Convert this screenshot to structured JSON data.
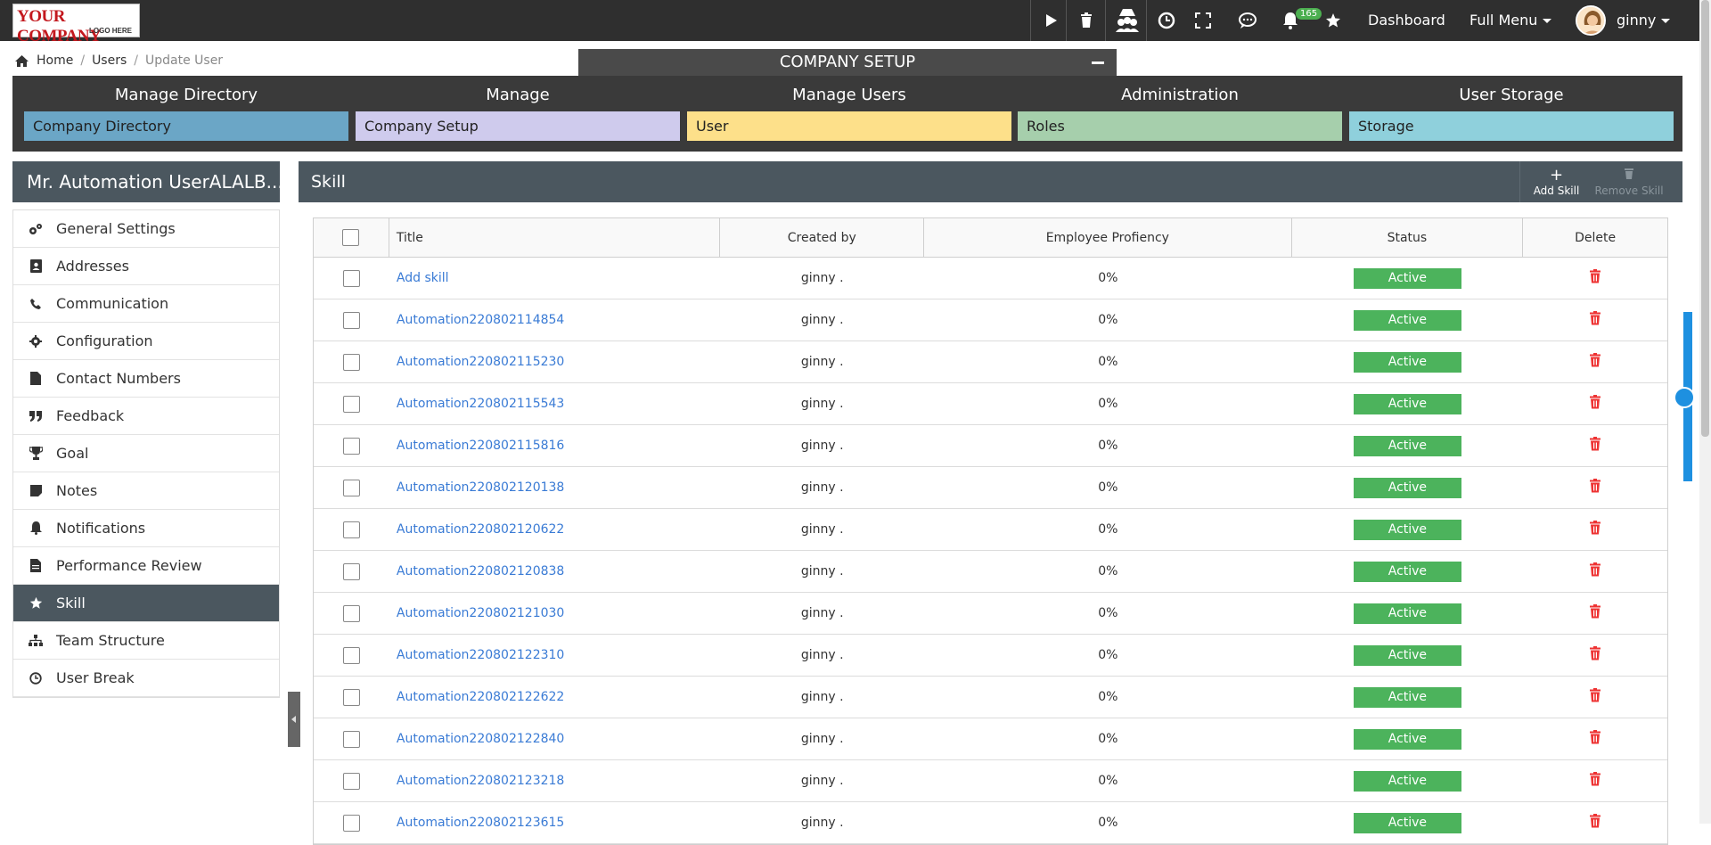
{
  "logo": {
    "line1": "YOUR COMPANY",
    "line2": "LOGO HERE"
  },
  "topbar": {
    "icons": [
      "play-icon",
      "trash-icon",
      "admin-users-icon",
      "clock-icon",
      "fullscreen-icon",
      "chat-icon",
      "bell-icon",
      "star-icon"
    ],
    "notification_count": "165",
    "dashboard": "Dashboard",
    "full_menu": "Full Menu",
    "user": "ginny"
  },
  "breadcrumb": {
    "home": "Home",
    "users": "Users",
    "current": "Update User"
  },
  "company_setup": {
    "title": "COMPANY SETUP",
    "columns": [
      {
        "header": "Manage Directory",
        "button": "Company Directory",
        "color": "#6ba6c6"
      },
      {
        "header": "Manage",
        "button": "Company Setup",
        "color": "#cfcbed"
      },
      {
        "header": "Manage Users",
        "button": "User",
        "color": "#fde08a"
      },
      {
        "header": "Administration",
        "button": "Roles",
        "color": "#a6cfac"
      },
      {
        "header": "User Storage",
        "button": "Storage",
        "color": "#8fd0dc"
      }
    ]
  },
  "sidebar": {
    "user_name": "Mr. Automation UserALALB...",
    "items": [
      {
        "label": "General Settings",
        "icon": "gears-icon"
      },
      {
        "label": "Addresses",
        "icon": "address-book-icon"
      },
      {
        "label": "Communication",
        "icon": "phone-icon"
      },
      {
        "label": "Configuration",
        "icon": "gear-icon"
      },
      {
        "label": "Contact Numbers",
        "icon": "file-icon"
      },
      {
        "label": "Feedback",
        "icon": "quote-icon"
      },
      {
        "label": "Goal",
        "icon": "trophy-icon"
      },
      {
        "label": "Notes",
        "icon": "note-icon"
      },
      {
        "label": "Notifications",
        "icon": "bell-icon"
      },
      {
        "label": "Performance Review",
        "icon": "document-icon"
      },
      {
        "label": "Skill",
        "icon": "star-icon",
        "active": true
      },
      {
        "label": "Team Structure",
        "icon": "sitemap-icon"
      },
      {
        "label": "User Break",
        "icon": "clock-icon"
      }
    ]
  },
  "skill": {
    "title": "Skill",
    "add_button": "Add Skill",
    "remove_button": "Remove Skill",
    "columns": [
      "Title",
      "Created by",
      "Employee Profiency",
      "Status",
      "Delete"
    ],
    "rows": [
      {
        "title": "Add skill",
        "created_by": "ginny .",
        "proficiency": "0%",
        "status": "Active"
      },
      {
        "title": "Automation220802114854",
        "created_by": "ginny .",
        "proficiency": "0%",
        "status": "Active"
      },
      {
        "title": "Automation220802115230",
        "created_by": "ginny .",
        "proficiency": "0%",
        "status": "Active"
      },
      {
        "title": "Automation220802115543",
        "created_by": "ginny .",
        "proficiency": "0%",
        "status": "Active"
      },
      {
        "title": "Automation220802115816",
        "created_by": "ginny .",
        "proficiency": "0%",
        "status": "Active"
      },
      {
        "title": "Automation220802120138",
        "created_by": "ginny .",
        "proficiency": "0%",
        "status": "Active"
      },
      {
        "title": "Automation220802120622",
        "created_by": "ginny .",
        "proficiency": "0%",
        "status": "Active"
      },
      {
        "title": "Automation220802120838",
        "created_by": "ginny .",
        "proficiency": "0%",
        "status": "Active"
      },
      {
        "title": "Automation220802121030",
        "created_by": "ginny .",
        "proficiency": "0%",
        "status": "Active"
      },
      {
        "title": "Automation220802122310",
        "created_by": "ginny .",
        "proficiency": "0%",
        "status": "Active"
      },
      {
        "title": "Automation220802122622",
        "created_by": "ginny .",
        "proficiency": "0%",
        "status": "Active"
      },
      {
        "title": "Automation220802122840",
        "created_by": "ginny .",
        "proficiency": "0%",
        "status": "Active"
      },
      {
        "title": "Automation220802123218",
        "created_by": "ginny .",
        "proficiency": "0%",
        "status": "Active"
      },
      {
        "title": "Automation220802123615",
        "created_by": "ginny .",
        "proficiency": "0%",
        "status": "Active"
      }
    ]
  }
}
